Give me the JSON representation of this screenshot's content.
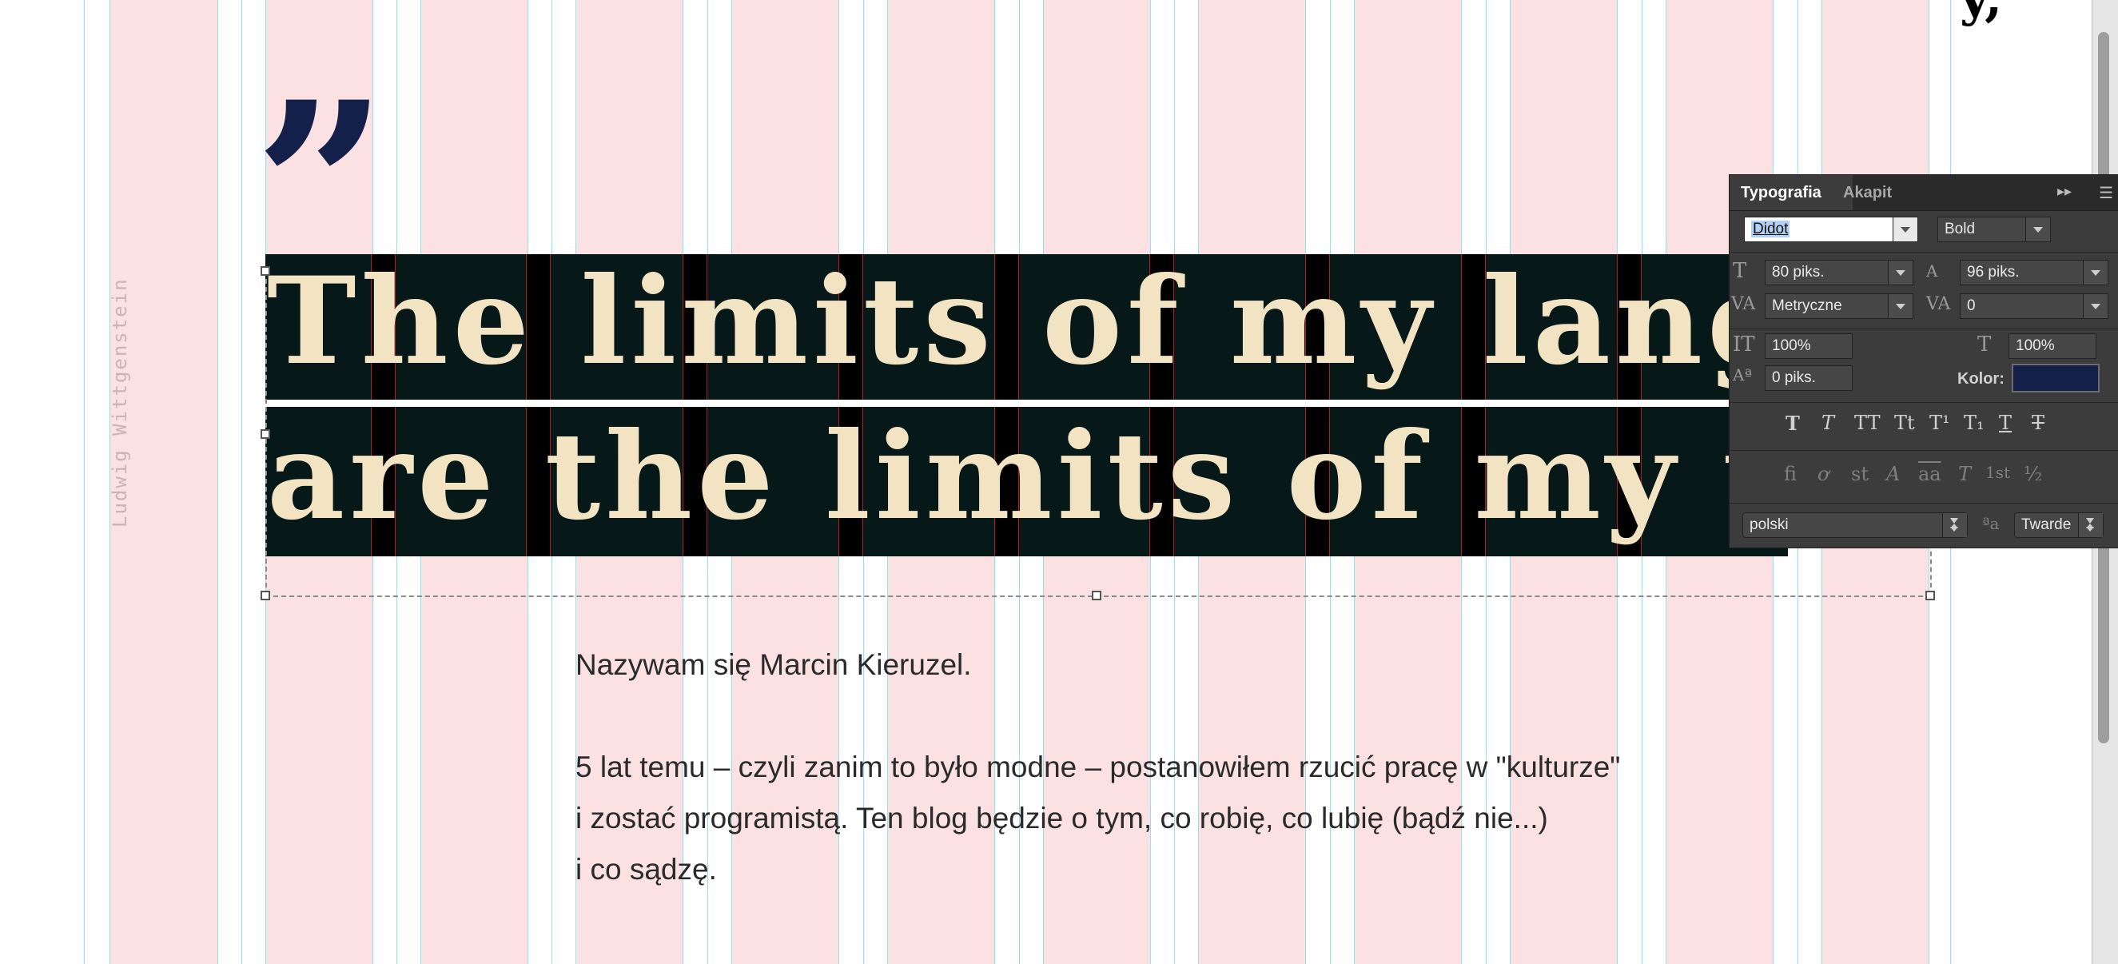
{
  "page": {
    "author_sidebar": "Ludwig Wittgenstein",
    "quote_mark": "”",
    "headline_line1": "The limits of my languag",
    "headline_line2": "are the limits of my world",
    "corner_glyph": "y,",
    "body_intro": "Nazywam się Marcin Kieruzel.",
    "body_line1": "5 lat temu – czyli zanim to było modne – postanowiłem rzucić pracę w \"kulturze\"",
    "body_line2": "i zostać programistą. Ten blog będzie o tym, co robię, co lubię (bądź nie...)",
    "body_line3": "i co sądzę."
  },
  "panel": {
    "tabs": [
      "Typografia",
      "Akapit"
    ],
    "collapse_glyph": "▸▸",
    "menu_glyph": "☰",
    "font_family": "Didot",
    "font_style": "Bold",
    "font_size": "80 piks.",
    "leading": "96 piks.",
    "kerning": "Metryczne",
    "tracking": "0",
    "vertical_scale": "100%",
    "horizontal_scale": "100%",
    "baseline_shift": "0 piks.",
    "color_label": "Kolor:",
    "color_value": "#13204a",
    "format_buttons": [
      "T",
      "T",
      "TT",
      "Tt",
      "T¹",
      "T₁",
      "T",
      "T"
    ],
    "opentype_buttons": [
      "fi",
      "ơ",
      "st",
      "A",
      "aa",
      "T",
      "1st",
      "½"
    ],
    "language": "polski",
    "aa_icon": "ªa",
    "antialias": "Twarde"
  },
  "colors": {
    "grid_pink": "#fbe1e2",
    "guide_cyan": "#8fe3ec",
    "band_dark": "#061818",
    "headline_cream": "#f2e3c2",
    "quote_navy": "#13204a"
  }
}
